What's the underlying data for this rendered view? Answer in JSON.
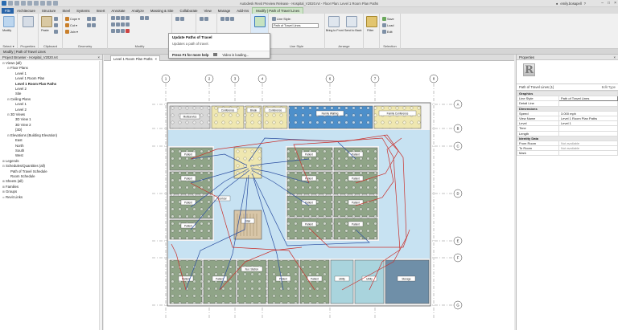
{
  "window": {
    "title": "Autodesk Revit Preview Release - Hospital_V2020.rvt - Floor Plan: Level 1 Room Plan Paths",
    "user": "emily.bosapell",
    "help": "?",
    "controls": [
      "–",
      "□",
      "×"
    ]
  },
  "ribbon_tabs": [
    "File",
    "Architecture",
    "Structure",
    "Steel",
    "Systems",
    "Insert",
    "Annotate",
    "Analyze",
    "Massing & Site",
    "Collaborate",
    "View",
    "Manage",
    "Add-Ins",
    "Modify | Path of Travel Lines"
  ],
  "ribbon": {
    "select": {
      "label": "Select ▾",
      "modify": "Modify"
    },
    "properties_label": "Properties",
    "clipboard_label": "Clipboard",
    "clipboard_paste": "Paste",
    "geometry_label": "Geometry",
    "geometry_cut": "Cut ▾",
    "geometry_join": "Join ▾",
    "geometry_cope": "Cope ▾",
    "modify_label": "Modify",
    "view_label": "View",
    "measure_label": "Measure",
    "create_label": "Create",
    "line_style": {
      "label": "Line Style",
      "field": "Line Style:",
      "value": "Path of Travel Lines"
    },
    "arrange": {
      "label": "Arrange",
      "bring_front": "Bring to Front",
      "send_back": "Send to Back"
    },
    "filter_label": "Filter",
    "selection": {
      "label": "Selection",
      "save": "Save",
      "load": "Load",
      "edit": "Edit"
    }
  },
  "modify_bar": "Modify | Path of Travel Lines",
  "tooltip": {
    "title": "Update Paths of Travel",
    "description": "Updates a path of travel.",
    "help_text": "Press F1 for more help",
    "video_text": "Video is loading..."
  },
  "project_browser": {
    "title": "Project Browser - Hospital_V2020.rvt",
    "close": "×",
    "items": [
      {
        "label": "Views (all)",
        "depth": 0,
        "tw": "⊟"
      },
      {
        "label": "Floor Plans",
        "depth": 1,
        "tw": "⊟"
      },
      {
        "label": "Level 1",
        "depth": 2,
        "tw": ""
      },
      {
        "label": "Level 1 Room Plan",
        "depth": 2,
        "tw": ""
      },
      {
        "label": "Level 1 Room Plan Paths",
        "depth": 2,
        "tw": "",
        "selected": true
      },
      {
        "label": "Level 2",
        "depth": 2,
        "tw": ""
      },
      {
        "label": "Site",
        "depth": 2,
        "tw": ""
      },
      {
        "label": "Ceiling Plans",
        "depth": 1,
        "tw": "⊟"
      },
      {
        "label": "Level 1",
        "depth": 2,
        "tw": ""
      },
      {
        "label": "Level 2",
        "depth": 2,
        "tw": ""
      },
      {
        "label": "3D Views",
        "depth": 1,
        "tw": "⊟"
      },
      {
        "label": "3D View 1",
        "depth": 2,
        "tw": ""
      },
      {
        "label": "3D View 2",
        "depth": 2,
        "tw": ""
      },
      {
        "label": "{3D}",
        "depth": 2,
        "tw": ""
      },
      {
        "label": "Elevations (Building Elevation)",
        "depth": 1,
        "tw": "⊟"
      },
      {
        "label": "East",
        "depth": 2,
        "tw": ""
      },
      {
        "label": "North",
        "depth": 2,
        "tw": ""
      },
      {
        "label": "South",
        "depth": 2,
        "tw": ""
      },
      {
        "label": "West",
        "depth": 2,
        "tw": ""
      },
      {
        "label": "Legends",
        "depth": 0,
        "tw": "⊞"
      },
      {
        "label": "Schedules/Quantities (all)",
        "depth": 0,
        "tw": "⊟"
      },
      {
        "label": "Path of Travel Schedule",
        "depth": 1,
        "tw": ""
      },
      {
        "label": "Room Schedule",
        "depth": 1,
        "tw": ""
      },
      {
        "label": "Sheets (all)",
        "depth": 0,
        "tw": "⊞"
      },
      {
        "label": "Families",
        "depth": 0,
        "tw": "⊞"
      },
      {
        "label": "Groups",
        "depth": 0,
        "tw": "⊞"
      },
      {
        "label": "Revit Links",
        "depth": 0,
        "tw": "∞"
      }
    ]
  },
  "view_tab": {
    "label": "Level 1 Room Plan Paths",
    "close": "×"
  },
  "plan": {
    "grid_top": [
      "1",
      "2",
      "3",
      "4",
      "5",
      "6",
      "7",
      "8"
    ],
    "grid_right": [
      "A",
      "B",
      "C",
      "D",
      "E",
      "F",
      "G"
    ],
    "rooms": {
      "multiservice": "Multiservice",
      "conf1": "Conference",
      "break": "Break",
      "conf2": "Conference",
      "family_waiting": "Family Waiting",
      "family_conf": "Family Conference",
      "corridor": "Corridor",
      "stair": "Stair",
      "patient": "Patient",
      "nurse": "Nur. Station",
      "utility": "Utility",
      "storage": "Storage"
    }
  },
  "properties": {
    "title": "Properties",
    "close": "×",
    "logo": "R",
    "type_name": "Path of Travel Lines (1)",
    "filter_text": "Edit Type",
    "groups": [
      {
        "name": "Graphics",
        "rows": [
          {
            "k": "Line Style",
            "v": "Path of Travel Lines",
            "box": true
          },
          {
            "k": "Detail Line",
            "v": ""
          }
        ]
      },
      {
        "name": "Dimensions",
        "rows": [
          {
            "k": "Speed",
            "v": "3.000 mph"
          },
          {
            "k": "View Name",
            "v": "Level 1 Room Plan Paths"
          },
          {
            "k": "Level",
            "v": "Level 1"
          },
          {
            "k": "Time",
            "v": ""
          },
          {
            "k": "Length",
            "v": ""
          }
        ]
      },
      {
        "name": "Identity Data",
        "rows": [
          {
            "k": "From Room",
            "v": "Not available"
          },
          {
            "k": "To Room",
            "v": "Not available"
          },
          {
            "k": "Mark",
            "v": ""
          }
        ]
      }
    ]
  },
  "colors": {
    "revit_blue": "#2964a8",
    "ctx_tab": "#cfe4c9",
    "patient_room": "#8fa487",
    "conference": "#efe7b0",
    "waiting": "#4d8fca",
    "corridor": "#c7e2f2",
    "path_blue": "#2b4ea0",
    "path_red": "#c9302c"
  }
}
